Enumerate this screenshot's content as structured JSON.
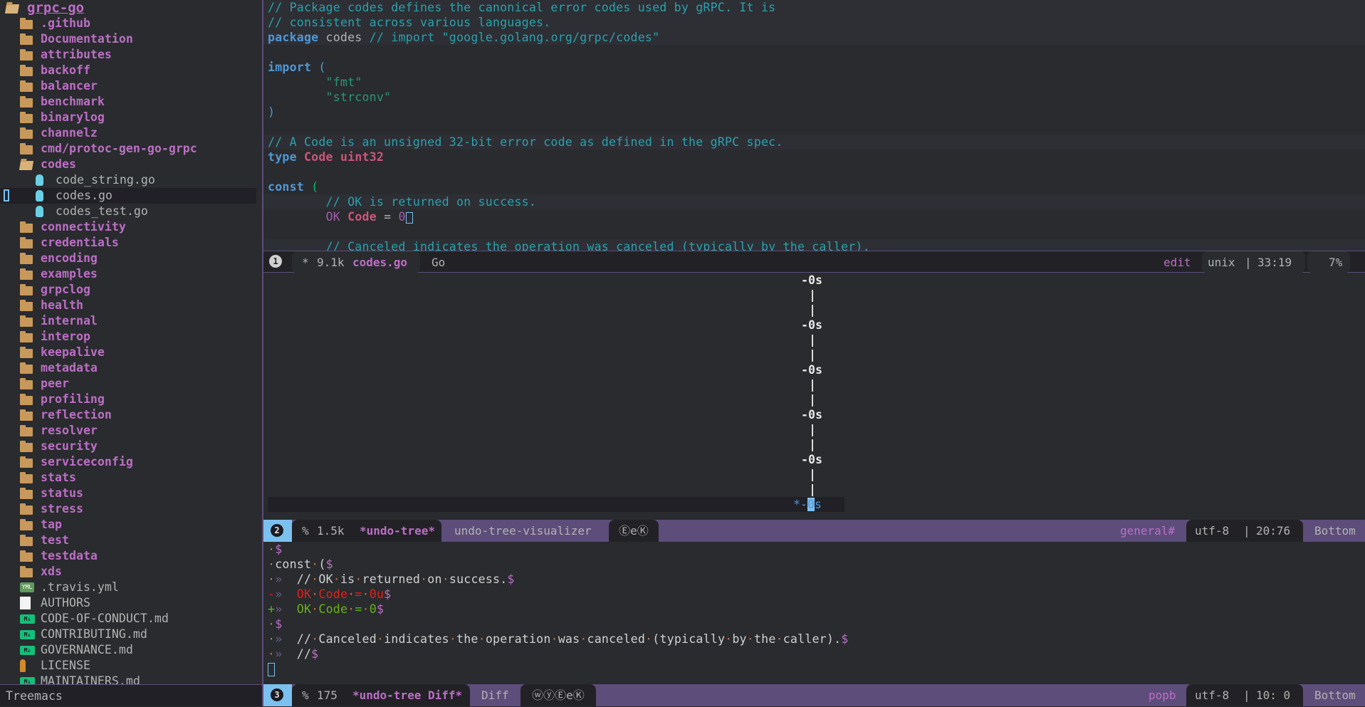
{
  "sidebar": {
    "root": "grpc-go",
    "items": [
      {
        "name": ".github",
        "type": "dir",
        "level": 1
      },
      {
        "name": "Documentation",
        "type": "dir",
        "level": 1
      },
      {
        "name": "attributes",
        "type": "dir",
        "level": 1
      },
      {
        "name": "backoff",
        "type": "dir",
        "level": 1
      },
      {
        "name": "balancer",
        "type": "dir",
        "level": 1
      },
      {
        "name": "benchmark",
        "type": "dir",
        "level": 1
      },
      {
        "name": "binarylog",
        "type": "dir",
        "level": 1
      },
      {
        "name": "channelz",
        "type": "dir",
        "level": 1
      },
      {
        "name": "cmd/protoc-gen-go-grpc",
        "type": "dir",
        "level": 1
      },
      {
        "name": "codes",
        "type": "dir-open",
        "level": 1
      },
      {
        "name": "code_string.go",
        "type": "go",
        "level": 2
      },
      {
        "name": "codes.go",
        "type": "go",
        "level": 2,
        "selected": true
      },
      {
        "name": "codes_test.go",
        "type": "go",
        "level": 2
      },
      {
        "name": "connectivity",
        "type": "dir",
        "level": 1
      },
      {
        "name": "credentials",
        "type": "dir",
        "level": 1
      },
      {
        "name": "encoding",
        "type": "dir",
        "level": 1
      },
      {
        "name": "examples",
        "type": "dir",
        "level": 1
      },
      {
        "name": "grpclog",
        "type": "dir",
        "level": 1
      },
      {
        "name": "health",
        "type": "dir",
        "level": 1
      },
      {
        "name": "internal",
        "type": "dir",
        "level": 1
      },
      {
        "name": "interop",
        "type": "dir",
        "level": 1
      },
      {
        "name": "keepalive",
        "type": "dir",
        "level": 1
      },
      {
        "name": "metadata",
        "type": "dir",
        "level": 1
      },
      {
        "name": "peer",
        "type": "dir",
        "level": 1
      },
      {
        "name": "profiling",
        "type": "dir",
        "level": 1
      },
      {
        "name": "reflection",
        "type": "dir",
        "level": 1
      },
      {
        "name": "resolver",
        "type": "dir",
        "level": 1
      },
      {
        "name": "security",
        "type": "dir",
        "level": 1
      },
      {
        "name": "serviceconfig",
        "type": "dir",
        "level": 1
      },
      {
        "name": "stats",
        "type": "dir",
        "level": 1
      },
      {
        "name": "status",
        "type": "dir",
        "level": 1
      },
      {
        "name": "stress",
        "type": "dir",
        "level": 1
      },
      {
        "name": "tap",
        "type": "dir",
        "level": 1
      },
      {
        "name": "test",
        "type": "dir",
        "level": 1
      },
      {
        "name": "testdata",
        "type": "dir",
        "level": 1
      },
      {
        "name": "xds",
        "type": "dir",
        "level": 1
      },
      {
        "name": ".travis.yml",
        "type": "yml",
        "level": 1
      },
      {
        "name": "AUTHORS",
        "type": "doc",
        "level": 1
      },
      {
        "name": "CODE-OF-CONDUCT.md",
        "type": "md",
        "level": 1
      },
      {
        "name": "CONTRIBUTING.md",
        "type": "md",
        "level": 1
      },
      {
        "name": "GOVERNANCE.md",
        "type": "md",
        "level": 1
      },
      {
        "name": "LICENSE",
        "type": "license",
        "level": 1
      },
      {
        "name": "MAINTAINERS.md",
        "type": "md",
        "level": 1
      }
    ],
    "icons": {
      "yml": "YML",
      "md": "M↓"
    },
    "modeline": "Treemacs"
  },
  "editor": {
    "lines": [
      [
        [
          "// Package codes defines the canonical error codes used by gRPC. It is",
          "c"
        ]
      ],
      [
        [
          "// consistent across various languages.",
          "c"
        ]
      ],
      [
        [
          "package",
          "k"
        ],
        [
          " codes ",
          "p"
        ],
        [
          "// import \"google.golang.org/grpc/codes\"",
          "c"
        ]
      ],
      [],
      [
        [
          "import",
          "k"
        ],
        [
          " (",
          "b"
        ]
      ],
      [
        [
          "\t",
          "p"
        ],
        [
          "\"fmt\"",
          "s"
        ]
      ],
      [
        [
          "\t",
          "p"
        ],
        [
          "\"strconv\"",
          "s"
        ]
      ],
      [
        [
          ")",
          "b"
        ]
      ],
      [],
      [
        [
          "// A Code is an unsigned 32-bit error code as defined in the gRPC spec.",
          "c"
        ]
      ],
      [
        [
          "type",
          "k"
        ],
        [
          " ",
          "p"
        ],
        [
          "Code",
          "t"
        ],
        [
          " ",
          "p"
        ],
        [
          "uint32",
          "t"
        ]
      ],
      [],
      [
        [
          "const",
          "k"
        ],
        [
          " ",
          "p"
        ],
        [
          "(",
          "g"
        ]
      ],
      [
        [
          "\t",
          "p"
        ],
        [
          "// OK is returned on success.",
          "c"
        ]
      ],
      [
        [
          "\t",
          "p"
        ],
        [
          "OK",
          "o"
        ],
        [
          " ",
          "p"
        ],
        [
          "Code",
          "t"
        ],
        [
          " = ",
          "p"
        ],
        [
          "0",
          "n"
        ]
      ],
      [],
      [
        [
          "\t",
          "p"
        ],
        [
          "// Canceled indicates the operation was canceled (typically by the caller).",
          "c"
        ]
      ]
    ],
    "modeline": {
      "window_number": "1",
      "modified": "*",
      "size": "9.1k",
      "buffer": "codes.go",
      "mode": "Go",
      "state": "edit",
      "eol": "unix",
      "position": "33:19",
      "percent": "7%"
    }
  },
  "undo_tree": {
    "node_label": "-0s",
    "edge": "|",
    "current_prefix": "*-",
    "current_digit": "0",
    "current_suffix": "s",
    "node_count": 6,
    "modeline": {
      "window_number": "2",
      "modified": "%",
      "size": "1.5k",
      "buffer": "*undo-tree*",
      "mode": "undo-tree-visualizer",
      "minor": "ⒺeⓀ",
      "state": "general#",
      "encoding": "utf-8",
      "position": "20:76",
      "scroll": "Bottom"
    }
  },
  "diff": {
    "lines": [
      [
        [
          "·",
          "ws"
        ],
        [
          "$",
          "eol"
        ]
      ],
      [
        [
          "·",
          "ws"
        ],
        [
          "const",
          "txt"
        ],
        [
          "·",
          "ws"
        ],
        [
          "(",
          "txt"
        ],
        [
          "$",
          "eol"
        ]
      ],
      [
        [
          "·",
          "ws"
        ],
        [
          "»  ",
          "tab"
        ],
        [
          "//",
          "txt"
        ],
        [
          "·",
          "ws"
        ],
        [
          "OK",
          "txt"
        ],
        [
          "·",
          "ws"
        ],
        [
          "is",
          "txt"
        ],
        [
          "·",
          "ws"
        ],
        [
          "returned",
          "txt"
        ],
        [
          "·",
          "ws"
        ],
        [
          "on",
          "txt"
        ],
        [
          "·",
          "ws"
        ],
        [
          "success.",
          "txt"
        ],
        [
          "$",
          "eol"
        ]
      ],
      [
        [
          "-",
          "del"
        ],
        [
          "»  ",
          "tab"
        ],
        [
          "OK",
          "del"
        ],
        [
          "·",
          "ws"
        ],
        [
          "Code",
          "del"
        ],
        [
          "·",
          "ws"
        ],
        [
          "=",
          "del"
        ],
        [
          "·",
          "ws"
        ],
        [
          "0u",
          "del"
        ],
        [
          "$",
          "eol"
        ]
      ],
      [
        [
          "+",
          "add"
        ],
        [
          "»  ",
          "tab"
        ],
        [
          "OK",
          "add"
        ],
        [
          "·",
          "ws"
        ],
        [
          "Code",
          "add"
        ],
        [
          "·",
          "ws"
        ],
        [
          "=",
          "add"
        ],
        [
          "·",
          "ws"
        ],
        [
          "0",
          "add"
        ],
        [
          "$",
          "eol"
        ]
      ],
      [
        [
          "·",
          "ws"
        ],
        [
          "$",
          "eol"
        ]
      ],
      [
        [
          "·",
          "ws"
        ],
        [
          "»  ",
          "tab"
        ],
        [
          "//",
          "txt"
        ],
        [
          "·",
          "ws"
        ],
        [
          "Canceled",
          "txt"
        ],
        [
          "·",
          "ws"
        ],
        [
          "indicates",
          "txt"
        ],
        [
          "·",
          "ws"
        ],
        [
          "the",
          "txt"
        ],
        [
          "·",
          "ws"
        ],
        [
          "operation",
          "txt"
        ],
        [
          "·",
          "ws"
        ],
        [
          "was",
          "txt"
        ],
        [
          "·",
          "ws"
        ],
        [
          "canceled",
          "txt"
        ],
        [
          "·",
          "ws"
        ],
        [
          "(typically",
          "txt"
        ],
        [
          "·",
          "ws"
        ],
        [
          "by",
          "txt"
        ],
        [
          "·",
          "ws"
        ],
        [
          "the",
          "txt"
        ],
        [
          "·",
          "ws"
        ],
        [
          "caller).",
          "txt"
        ],
        [
          "$",
          "eol"
        ]
      ],
      [
        [
          "·",
          "ws"
        ],
        [
          "»  ",
          "tab"
        ],
        [
          "//",
          "txt"
        ],
        [
          "$",
          "eol"
        ]
      ]
    ],
    "modeline": {
      "window_number": "3",
      "modified": "%",
      "size": "175",
      "buffer": "*undo-tree Diff*",
      "mode": "Diff",
      "minor": "ⓦⓨⒺeⓀ",
      "state": "popb",
      "encoding": "utf-8",
      "position": "10: 0",
      "scroll": "Bottom"
    }
  },
  "colors": {
    "accent": "#7bc1f0",
    "modeline_purple": "#5d4d7a",
    "dir": "#bc6ec5",
    "comment": "#2aa1ae",
    "keyword": "#4f97d7",
    "string": "#2d9574",
    "type": "#ce537a",
    "removed": "#e0211d",
    "added": "#67b11d"
  }
}
